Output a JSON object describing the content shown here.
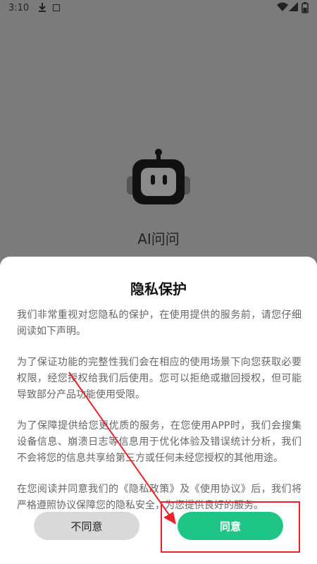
{
  "status_bar": {
    "time": "3:10",
    "download_icon": "download-arrow-icon",
    "app_icon": "notification-app-icon",
    "wifi_icon": "wifi-icon",
    "signal_icon": "cell-signal-icon",
    "battery_icon": "battery-icon"
  },
  "splash": {
    "logo_icon": "robot-icon",
    "app_name": "AI问问"
  },
  "dialog": {
    "title": "隐私保护",
    "paragraphs": [
      "我们非常重视对您隐私的保护，在使用提供的服务前，请您仔细阅读如下声明。",
      "为了保证功能的完整性我们会在相应的使用场景下向您获取必要权限，经您授权给我们后使用。您可以拒绝或撤回授权，但可能导致部分产品功能使用受限。",
      "为了保障提供给您更优质的服务，在您使用APP时，我们会搜集设备信息、崩溃日志等信息用于优化体验及错误统计分析，我们不会将您的信息共享给第三方或任何未经您授权的其他用途。",
      "在您阅读并同意我们的《隐私政策》及《使用协议》后，我们将严格遵照协议保障您的隐私安全，为您提供良好的服务。"
    ],
    "disagree_label": "不同意",
    "agree_label": "同意"
  },
  "colors": {
    "overlay": "#7b7b7b",
    "agree_button": "#1fc587",
    "disagree_button": "#d9d9d9",
    "annotation": "#e8242a"
  }
}
